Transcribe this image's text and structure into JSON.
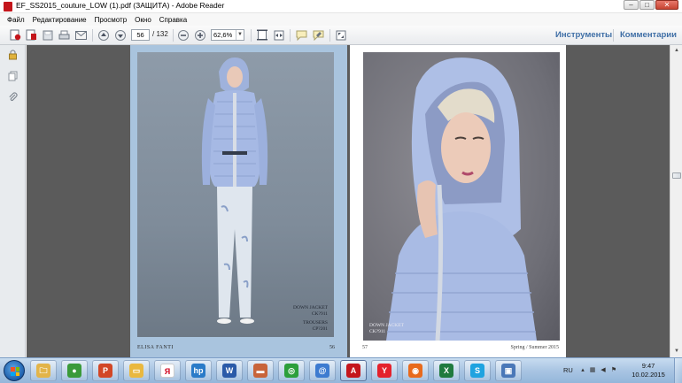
{
  "window": {
    "title": "EF_SS2015_couture_LOW (1).pdf (ЗАЩИТА) - Adobe Reader",
    "minimize": "–",
    "maximize": "□",
    "close": "✕"
  },
  "menu": [
    "Файл",
    "Редактирование",
    "Просмотр",
    "Окно",
    "Справка"
  ],
  "toolbar": {
    "page_current": "56",
    "page_total": "/ 132",
    "zoom": "62,6%",
    "zoom_arrow": "▼",
    "tools_label": "Инструменты",
    "comments_label": "Комментарии",
    "icons": [
      "create-pdf-icon",
      "open-icon",
      "save-icon",
      "print-icon",
      "email-icon",
      "prev-page-icon",
      "next-page-icon",
      "zoom-out-icon",
      "zoom-in-icon",
      "fit-page-icon",
      "fit-width-icon",
      "comment-icon",
      "highlight-icon",
      "fullscreen-icon"
    ]
  },
  "sidepanel": {
    "icons": [
      "lock-icon",
      "pages-icon",
      "attachment-icon"
    ]
  },
  "document": {
    "left_page": {
      "caption_line1": "DOWN JACKET",
      "caption_line2": "CK?911",
      "caption_line3": "TROUSERS",
      "caption_line4": "CP?201",
      "brand": "ELISA FANTI",
      "page_number": "56"
    },
    "right_page": {
      "caption_line1": "DOWN JACKET",
      "caption_line2": "CK?911",
      "page_number": "57",
      "season": "Spring / Summer 2015"
    }
  },
  "scrollbar": {
    "up": "▲",
    "down": "▼"
  },
  "taskbar": {
    "apps": [
      {
        "name": "explorer-icon",
        "glyph": "🗀",
        "color": "#e2b44a"
      },
      {
        "name": "chrome-icon",
        "glyph": "●",
        "color": "#3a9a3a"
      },
      {
        "name": "powerpoint-icon",
        "glyph": "P",
        "color": "#d24726"
      },
      {
        "name": "folder-icon",
        "glyph": "▭",
        "color": "#e9b840"
      },
      {
        "name": "yandex-icon",
        "glyph": "Я",
        "color": "#ffffff"
      },
      {
        "name": "hp-icon",
        "glyph": "hp",
        "color": "#2a7bc8"
      },
      {
        "name": "word-icon",
        "glyph": "W",
        "color": "#2a5aa8"
      },
      {
        "name": "media-icon",
        "glyph": "▬",
        "color": "#c8643a"
      },
      {
        "name": "chat-icon",
        "glyph": "◎",
        "color": "#2c9f3c"
      },
      {
        "name": "mail-icon",
        "glyph": "@",
        "color": "#3d7bd0"
      },
      {
        "name": "acrobat-icon",
        "glyph": "A",
        "color": "#c4161c"
      },
      {
        "name": "yandex-browser-icon",
        "glyph": "Y",
        "color": "#e4222c"
      },
      {
        "name": "firefox-icon",
        "glyph": "◉",
        "color": "#e86a1c"
      },
      {
        "name": "excel-icon",
        "glyph": "X",
        "color": "#1f7a3e"
      },
      {
        "name": "skype-icon",
        "glyph": "S",
        "color": "#1fa3e0"
      },
      {
        "name": "screen-icon",
        "glyph": "▣",
        "color": "#4a78b8"
      }
    ],
    "language": "RU",
    "time": "9:47",
    "date": "10.02.2015"
  }
}
